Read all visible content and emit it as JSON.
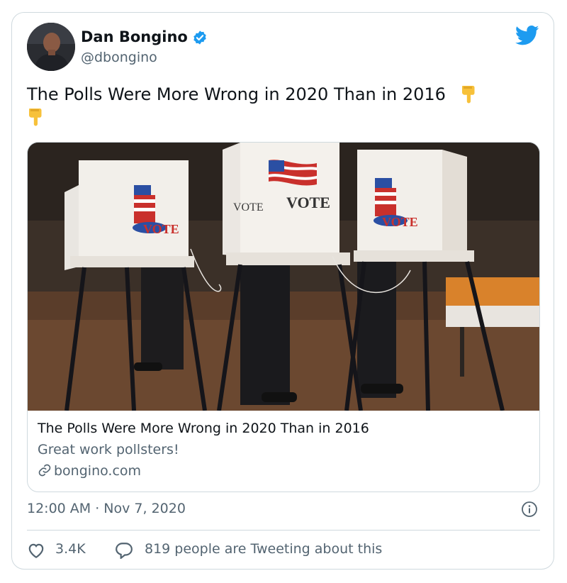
{
  "author": {
    "name": "Dan Bongino",
    "handle": "@dbongino"
  },
  "tweet": {
    "text": "The Polls Were More Wrong in 2020 Than in 2016",
    "emoji": [
      "pointing-down",
      "pointing-down"
    ]
  },
  "link_card": {
    "image_signs": [
      "VOTE",
      "VOTE",
      "VOTE",
      "VOTE"
    ],
    "title": "The Polls Were More Wrong in 2020 Than in 2016",
    "description": "Great work pollsters!",
    "domain": "bongino.com"
  },
  "meta": {
    "timestamp": "12:00 AM · Nov 7, 2020"
  },
  "actions": {
    "likes": "3.4K",
    "talking": "819 people are Tweeting about this"
  },
  "colors": {
    "brand_blue": "#1d9bf0",
    "text": "#0f1419",
    "muted": "#536471",
    "border": "#cfd9de"
  },
  "icons": [
    "verified-badge-icon",
    "twitter-bird-icon",
    "link-icon",
    "info-icon",
    "heart-icon",
    "reply-bubble-icon"
  ]
}
